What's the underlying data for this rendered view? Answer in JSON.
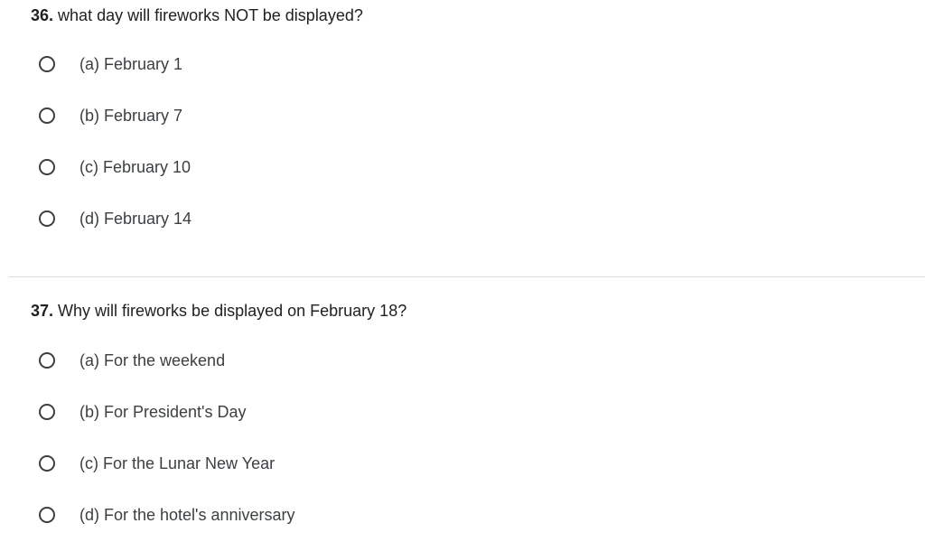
{
  "questions": [
    {
      "number": "36.",
      "text": "what day will fireworks NOT be displayed?",
      "options": [
        {
          "label": "(a) February 1"
        },
        {
          "label": "(b) February 7"
        },
        {
          "label": "(c) February 10"
        },
        {
          "label": "(d) February 14"
        }
      ]
    },
    {
      "number": "37.",
      "text": "Why will fireworks be displayed on February 18?",
      "options": [
        {
          "label": "(a) For the weekend"
        },
        {
          "label": "(b) For President's Day"
        },
        {
          "label": "(c) For the Lunar New Year"
        },
        {
          "label": "(d) For the hotel's anniversary"
        }
      ]
    }
  ]
}
